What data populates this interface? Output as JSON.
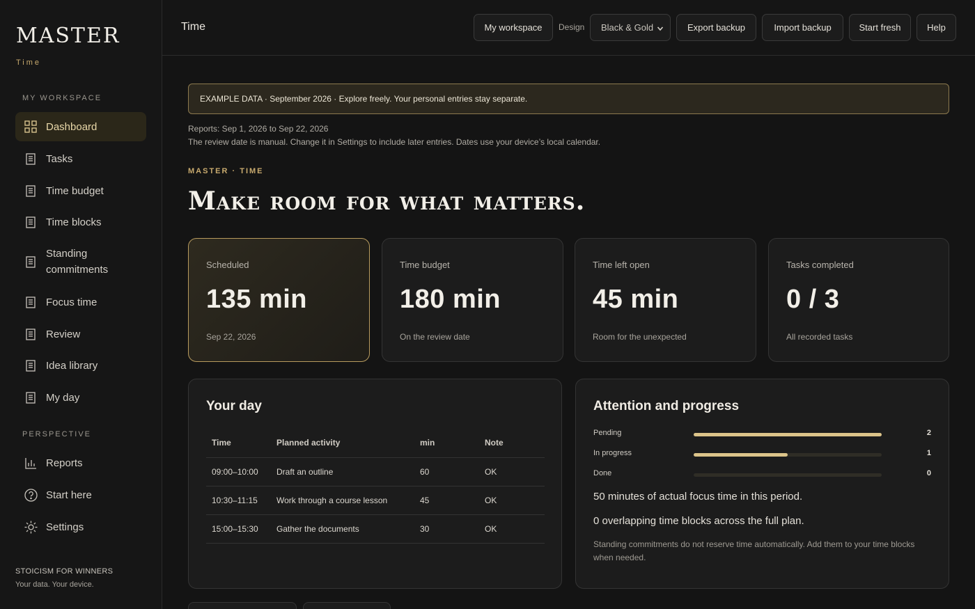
{
  "sidebar": {
    "logo": "MASTER",
    "logo_sub": "Time",
    "section_workspace": "MY WORKSPACE",
    "section_perspective": "PERSPECTIVE",
    "items": [
      {
        "label": "Dashboard",
        "icon": "grid-icon"
      },
      {
        "label": "Tasks",
        "icon": "document-icon"
      },
      {
        "label": "Time budget",
        "icon": "document-icon"
      },
      {
        "label": "Time blocks",
        "icon": "document-icon"
      },
      {
        "label": "Standing commitments",
        "icon": "document-icon"
      },
      {
        "label": "Focus time",
        "icon": "document-icon"
      },
      {
        "label": "Review",
        "icon": "document-icon"
      },
      {
        "label": "Idea library",
        "icon": "document-icon"
      },
      {
        "label": "My day",
        "icon": "document-icon"
      }
    ],
    "perspective_items": [
      {
        "label": "Reports",
        "icon": "bar-chart-icon"
      },
      {
        "label": "Start here",
        "icon": "help-circle-icon"
      },
      {
        "label": "Settings",
        "icon": "sun-gear-icon"
      }
    ],
    "footer_brand": "STOICISM FOR WINNERS",
    "footer_tagline": "Your data. Your device."
  },
  "header": {
    "title": "Time",
    "my_workspace": "My workspace",
    "design_label": "Design",
    "design_value": "Black & Gold",
    "export": "Export backup",
    "import": "Import backup",
    "start_fresh": "Start fresh",
    "help": "Help"
  },
  "main": {
    "banner": "EXAMPLE DATA · September 2026 · Explore freely. Your personal entries stay separate.",
    "reports_range": "Reports: Sep 1, 2026 to Sep 22, 2026",
    "review_note": "The review date is manual. Change it in Settings to include later entries. Dates use your device’s local calendar.",
    "eyebrow": "MASTER · TIME",
    "headline": "Make room for what matters."
  },
  "stats": [
    {
      "label": "Scheduled",
      "value": "135 min",
      "note": "Sep 22, 2026"
    },
    {
      "label": "Time budget",
      "value": "180 min",
      "note": "On the review date"
    },
    {
      "label": "Time left open",
      "value": "45 min",
      "note": "Room for the unexpected"
    },
    {
      "label": "Tasks completed",
      "value": "0 / 3",
      "note": "All recorded tasks"
    }
  ],
  "your_day": {
    "title": "Your day",
    "columns": [
      "Time",
      "Planned activity",
      "min",
      "Note"
    ],
    "rows": [
      [
        "09:00–10:00",
        "Draft an outline",
        "60",
        "OK"
      ],
      [
        "10:30–11:15",
        "Work through a course lesson",
        "45",
        "OK"
      ],
      [
        "15:00–15:30",
        "Gather the documents",
        "30",
        "OK"
      ]
    ]
  },
  "attention": {
    "title": "Attention and progress",
    "bars": [
      {
        "label": "Pending",
        "count": "2",
        "fraction": 1.0
      },
      {
        "label": "In progress",
        "count": "1",
        "fraction": 0.5
      },
      {
        "label": "Done",
        "count": "0",
        "fraction": 0.0
      }
    ],
    "focus_line": "50 minutes of actual focus time in this period.",
    "overlap_line": "0 overlapping time blocks across the full plan.",
    "note": "Standing commitments do not reserve time automatically. Add them to your time blocks when needed."
  },
  "colors": {
    "accent": "#c8aa6e",
    "bar_fill": "#dcc48a",
    "background": "#141414"
  }
}
